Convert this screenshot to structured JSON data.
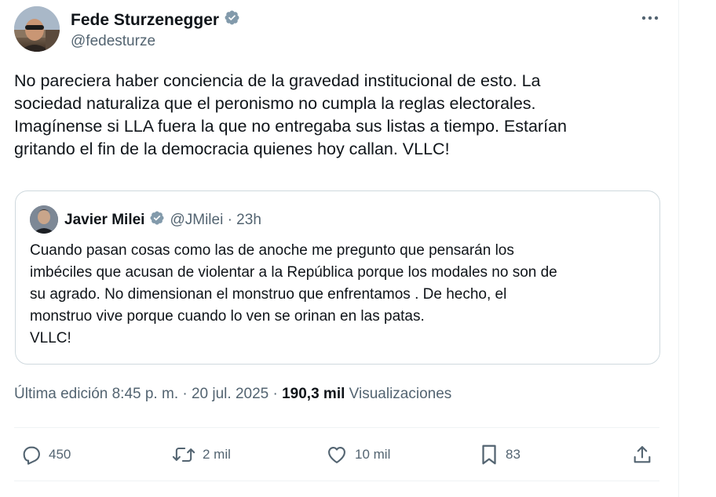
{
  "author": {
    "name": "Fede Sturzenegger",
    "handle": "@fedesturze",
    "verified": true
  },
  "tweet": {
    "lines": [
      "No pareciera haber conciencia de la gravedad institucional de esto. La",
      "sociedad naturaliza que el peronismo no cumpla la reglas electorales.",
      "Imagínense si LLA fuera la que no entregaba sus listas a tiempo. Estarían",
      "gritando el fin de la democracia quienes hoy callan. VLLC!"
    ]
  },
  "quote": {
    "name": "Javier Milei",
    "handle_time": "@JMilei · 23h",
    "verified": true,
    "lines": [
      "Cuando pasan cosas como las de anoche me pregunto que pensarán los",
      "imbéciles que acusan de violentar a la República porque los modales no son de",
      "su agrado. No dimensionan el monstruo que enfrentamos . De hecho, el",
      "monstruo vive porque cuando lo ven se orinan en las patas.",
      "VLLC!"
    ]
  },
  "meta": {
    "edited_time": "Última edición 8:45 p. m. · 20 jul. 2025 · ",
    "views_count": "190,3 mil",
    "views_label": " Visualizaciones"
  },
  "actions": {
    "replies": "450",
    "retweets": "2 mil",
    "likes": "10 mil",
    "bookmarks": "83"
  },
  "colors": {
    "text": "#0f1419",
    "secondary": "#536471",
    "verified": "#829aab",
    "border": "#cfd9de"
  },
  "icons": [
    "more-icon",
    "verified-icon",
    "reply-icon",
    "retweet-icon",
    "like-icon",
    "bookmark-icon",
    "share-icon"
  ]
}
